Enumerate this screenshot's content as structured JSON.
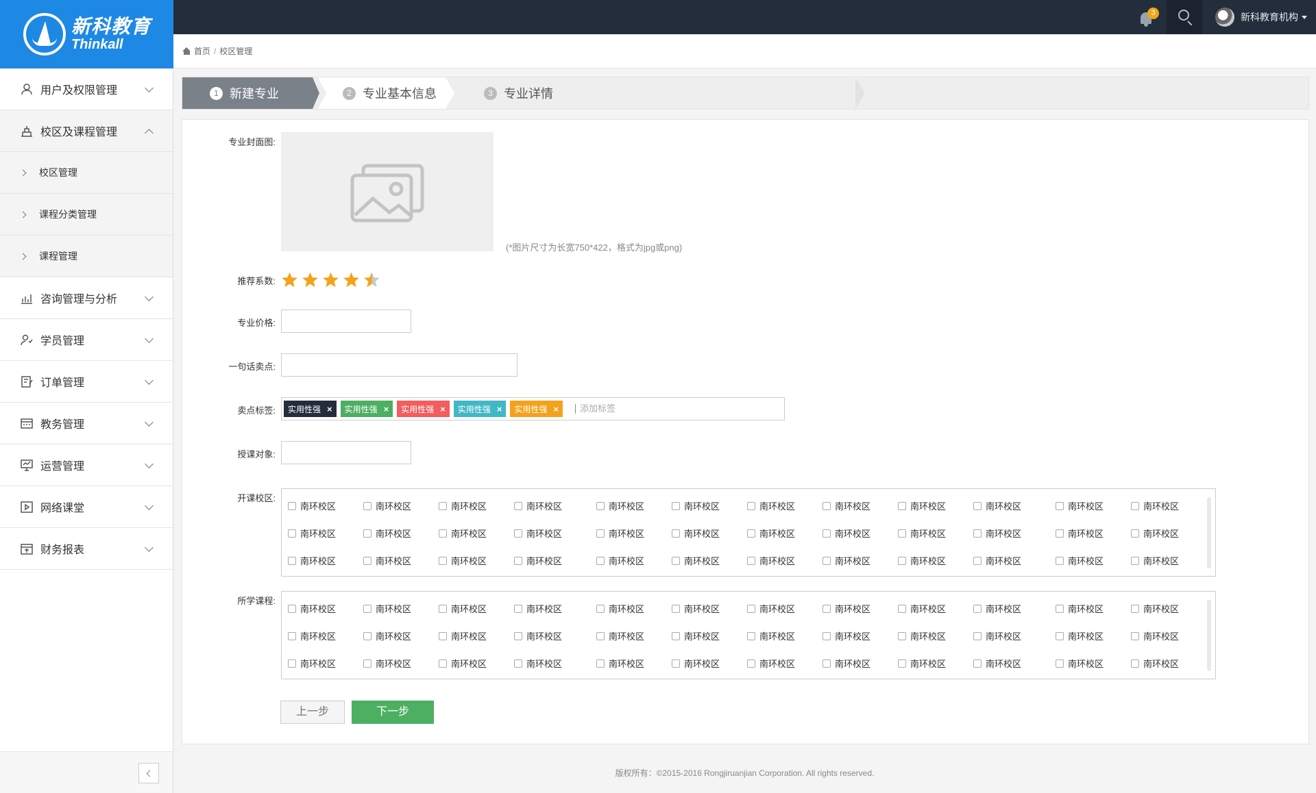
{
  "logo": {
    "cn": "新科教育",
    "en": "Thinkall"
  },
  "topbar": {
    "notification_count": "3",
    "user_name": "新科教育机构"
  },
  "sidebar": {
    "items": [
      {
        "label": "用户及权限管理",
        "icon": "user-icon",
        "expanded": false
      },
      {
        "label": "校区及课程管理",
        "icon": "building-icon",
        "expanded": true,
        "children": [
          {
            "label": "校区管理"
          },
          {
            "label": "课程分类管理"
          },
          {
            "label": "课程管理"
          }
        ]
      },
      {
        "label": "咨询管理与分析",
        "icon": "chart-icon",
        "expanded": false
      },
      {
        "label": "学员管理",
        "icon": "students-icon",
        "expanded": false
      },
      {
        "label": "订单管理",
        "icon": "order-icon",
        "expanded": false
      },
      {
        "label": "教务管理",
        "icon": "erp-icon",
        "expanded": false
      },
      {
        "label": "运营管理",
        "icon": "monitor-icon",
        "expanded": false
      },
      {
        "label": "网络课堂",
        "icon": "video-icon",
        "expanded": false
      },
      {
        "label": "财务报表",
        "icon": "report-icon",
        "expanded": false
      }
    ]
  },
  "breadcrumb": {
    "home": "首页",
    "separator": "/",
    "current": "校区管理"
  },
  "steps": [
    {
      "num": "1",
      "label": "新建专业",
      "active": true
    },
    {
      "num": "2",
      "label": "专业基本信息",
      "active": false
    },
    {
      "num": "3",
      "label": "专业详情",
      "active": false
    }
  ],
  "form": {
    "cover_label": "专业封面图:",
    "cover_note": "(*图片尺寸为长宽750*422，格式为jpg或png)",
    "rating_label": "推荐系数:",
    "rating_value": 4.5,
    "rating_max": 5,
    "price_label": "专业价格:",
    "price_value": "",
    "selling_point_label": "一句话卖点:",
    "selling_point_value": "",
    "tags_label": "卖点标签:",
    "tags": [
      {
        "text": "实用性强",
        "color": "#232d3b"
      },
      {
        "text": "实用性强",
        "color": "#4caf62"
      },
      {
        "text": "实用性强",
        "color": "#f25d5d"
      },
      {
        "text": "实用性强",
        "color": "#42b8c5"
      },
      {
        "text": "实用性强",
        "color": "#f4a21c"
      }
    ],
    "tag_remove": "×",
    "tag_add_placeholder": "添加标签",
    "audience_label": "授课对象:",
    "audience_value": "",
    "campus_label": "开课校区:",
    "course_label": "所学课程:",
    "option_text": "南环校区",
    "campus_rows": [
      [
        "南环校区",
        "南环校区",
        "南环校区",
        "南环校区",
        "南环校区",
        "南环校区",
        "南环校区",
        "南环校区",
        "南环校区",
        "南环校区",
        "南环校区",
        "南环校区"
      ],
      [
        "南环校区",
        "南环校区",
        "南环校区",
        "南环校区",
        "南环校区",
        "南环校区",
        "南环校区",
        "南环校区",
        "南环校区",
        "南环校区",
        "南环校区",
        "南环校区"
      ],
      [
        "南环校区",
        "南环校区",
        "南环校区",
        "南环校区",
        "南环校区",
        "南环校区",
        "南环校区",
        "南环校区",
        "南环校区",
        "南环校区",
        "南环校区",
        "南环校区"
      ]
    ],
    "course_rows": [
      [
        "南环校区",
        "南环校区",
        "南环校区",
        "南环校区",
        "南环校区",
        "南环校区",
        "南环校区",
        "南环校区",
        "南环校区",
        "南环校区",
        "南环校区",
        "南环校区"
      ],
      [
        "南环校区",
        "南环校区",
        "南环校区",
        "南环校区",
        "南环校区",
        "南环校区",
        "南环校区",
        "南环校区",
        "南环校区",
        "南环校区",
        "南环校区",
        "南环校区"
      ],
      [
        "南环校区",
        "南环校区",
        "南环校区",
        "南环校区",
        "南环校区",
        "南环校区",
        "南环校区",
        "南环校区",
        "南环校区",
        "南环校区",
        "南环校区",
        "南环校区"
      ]
    ],
    "prev_button": "上一步",
    "next_button": "下一步"
  },
  "footer": {
    "text": "版权所有：©2015-2016 Rongjiruanjian Corporation. All rights reserved."
  },
  "colors": {
    "brand": "#1e88e5",
    "topbar": "#232d3b",
    "next_button": "#4caf62",
    "star": "#f4a21c"
  }
}
